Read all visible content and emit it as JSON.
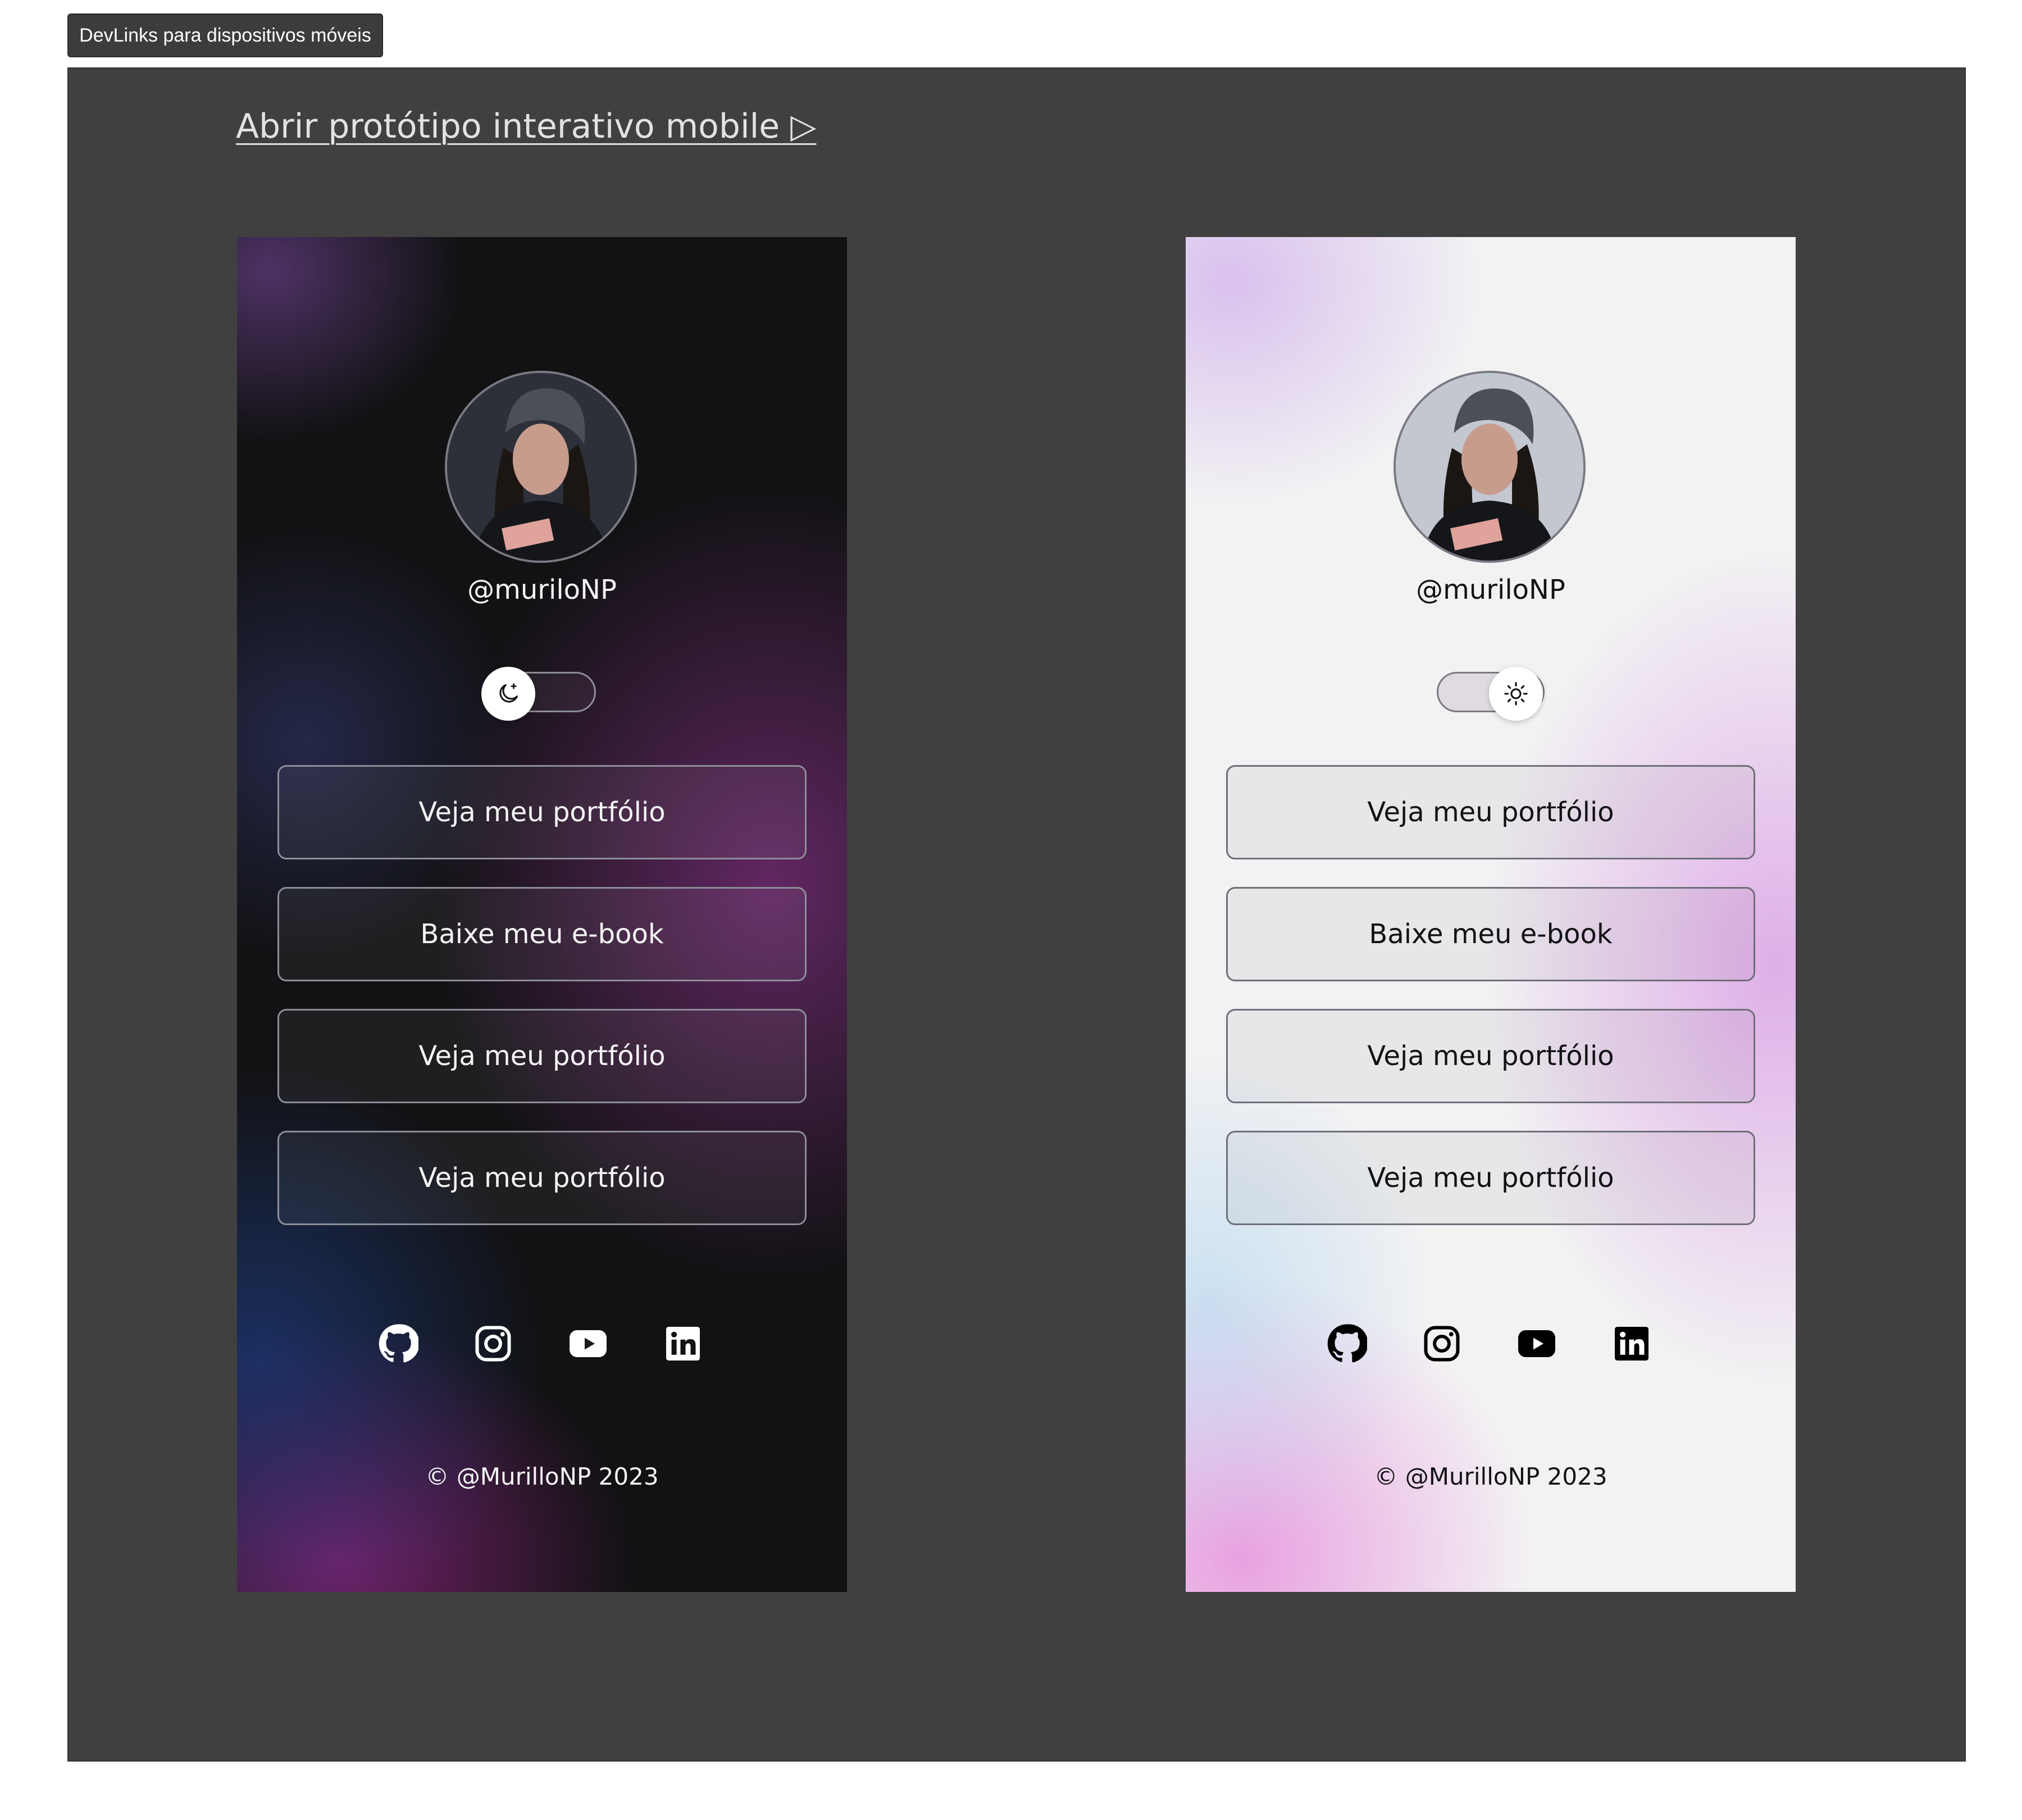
{
  "frame_label": "DevLinks para dispositivos móveis",
  "prototype_link": "Abrir protótipo interativo mobile ▷",
  "dark": {
    "username": "@muriloNP",
    "buttons": [
      "Veja meu portfólio",
      "Baixe meu e-book",
      "Veja meu portfólio",
      "Veja meu portfólio"
    ],
    "socials": [
      "github-icon",
      "instagram-icon",
      "youtube-icon",
      "linkedin-icon"
    ],
    "toggle": {
      "mode": "dark",
      "icon": "moon-icon"
    },
    "footer": "© @MurilloNP 2023"
  },
  "light": {
    "username": "@muriloNP",
    "buttons": [
      "Veja meu portfólio",
      "Baixe meu e-book",
      "Veja meu portfólio",
      "Veja meu portfólio"
    ],
    "socials": [
      "github-icon",
      "instagram-icon",
      "youtube-icon",
      "linkedin-icon"
    ],
    "toggle": {
      "mode": "light",
      "icon": "sun-icon"
    },
    "footer": "© @MurilloNP 2023"
  },
  "colors": {
    "canvas_bg": "#404040",
    "dark_bg": "#121214",
    "light_bg": "#f2f2f3",
    "dark_text": "#f4f4f5",
    "light_text": "#121214"
  }
}
